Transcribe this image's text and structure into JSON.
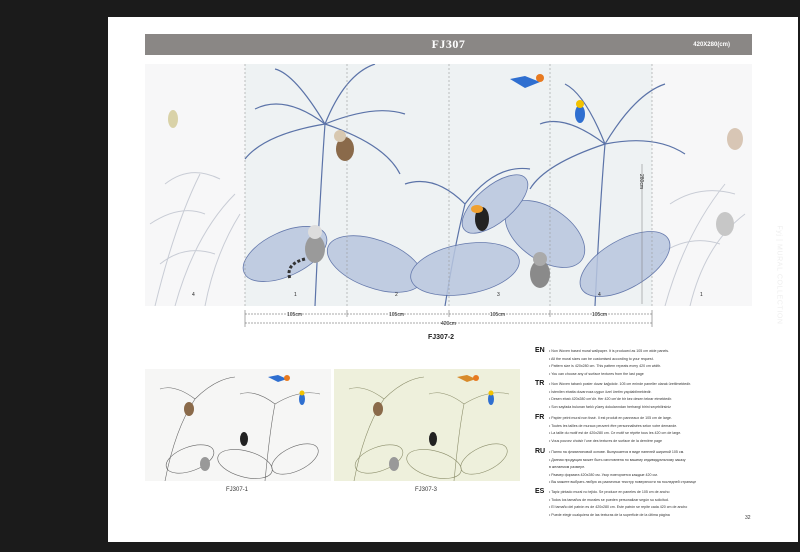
{
  "header": {
    "title": "FJ307",
    "size": "420X280(cm)"
  },
  "mural": {
    "panel_numbers": [
      "4",
      "1",
      "2",
      "3",
      "4",
      "1"
    ],
    "height_label": "280cm"
  },
  "dimensions": {
    "panels": [
      "105cm",
      "105cm",
      "105cm",
      "105cm"
    ],
    "total": "420cm"
  },
  "variant_code": "FJ307-2",
  "thumbnails": [
    {
      "label": "FJ307-1"
    },
    {
      "label": "FJ307-3"
    }
  ],
  "languages": [
    {
      "code": "EN",
      "lines": [
        "• Non Woven based mural wallpaper. It is produced as 105 cm wide panels.",
        "• All the mural sizes can be customised according to your request.",
        "• Pattern size is 420x280 cm. This pattern repeats every 420 cm width.",
        "• You can choose any of surface textures from the last page"
      ]
    },
    {
      "code": "TR",
      "lines": [
        "• Non Woven tabanlı poster duvar kağıdıdır. 105 cm eninde paneller olarak üretilmektedir.",
        "• İstenilen ebatta duvarınıza uygun özel üretim yapılabilmektedir.",
        "• Desen ebatı 420x280 cm'dir. Her 420 cm'de bir kez desen tekrar etmektedir.",
        "• Son sayfada bulunan farklı yüzey dokularından herhangi birini seçebilirsiniz"
      ]
    },
    {
      "code": "FR",
      "lines": [
        "• Papier peint mural non tissé. Il est produit en panneaux de 105 cm de large.",
        "• Toutes les tailles de muraux peuvent être personnalisées selon votre demande.",
        "• La taille du motif est de 420x280 cm. Ce motif se répète tous les 420 cm de large.",
        "• Vous pouvez choisir l'une des textures de surface de la dernière page"
      ]
    },
    {
      "code": "RU",
      "lines": [
        "• Панно на флизелиновой основе. Выпускается в виде панелей шириной 105 см.",
        "• Данная продукция может быть изготовлена по вашему индивидуальному заказу",
        "  в желаемом размере.",
        "• Размер формата 420х280 см. Узор повторяется каждые 420 см.",
        "• Вы можете выбрать любую из различных текстур поверхности на последней странице"
      ]
    },
    {
      "code": "ES",
      "lines": [
        "• Tapiz pintado mural no tejido. Se produce en paneles de 105 cm de ancho",
        "• Todos los tamaños de murales se pueden personalizar según su solicitud.",
        "• El tamaño del patrón es de 420x280 cm. Este patrón se repite cada 420 cm de ancho",
        "• Puede elegir cualquiera de las texturas de la superficie de la última página"
      ]
    }
  ],
  "side_brand": "Fyj | MURAL COLLECTION",
  "page_number": "32",
  "colors": {
    "background": "#1b1b1b",
    "header_bar": "#8a8785",
    "foliage_blue": "#5b73a8",
    "parrot_blue": "#2f6fd0"
  }
}
